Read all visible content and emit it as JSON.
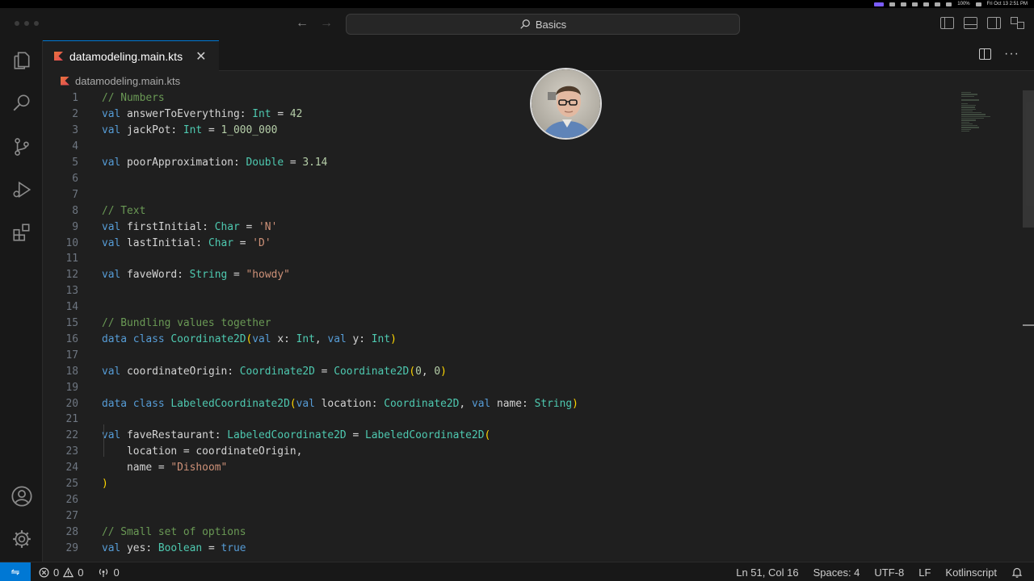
{
  "titlebar": {
    "search_label": "Basics",
    "menubar_clock": "Fri Oct 13  2:51 PM",
    "battery": "100%"
  },
  "tab": {
    "label": "datamodeling.main.kts"
  },
  "breadcrumb": {
    "label": "datamodeling.main.kts"
  },
  "editor": {
    "lines": [
      {
        "n": "1",
        "tokens": [
          [
            "cm",
            "// Numbers"
          ]
        ]
      },
      {
        "n": "2",
        "tokens": [
          [
            "kw",
            "val "
          ],
          [
            "pl",
            "answerToEverything: "
          ],
          [
            "ty",
            "Int"
          ],
          [
            "pl",
            " = "
          ],
          [
            "nm",
            "42"
          ]
        ]
      },
      {
        "n": "3",
        "tokens": [
          [
            "kw",
            "val "
          ],
          [
            "pl",
            "jackPot: "
          ],
          [
            "ty",
            "Int"
          ],
          [
            "pl",
            " = "
          ],
          [
            "nm",
            "1_000_000"
          ]
        ]
      },
      {
        "n": "4",
        "tokens": []
      },
      {
        "n": "5",
        "tokens": [
          [
            "kw",
            "val "
          ],
          [
            "pl",
            "poorApproximation: "
          ],
          [
            "ty",
            "Double"
          ],
          [
            "pl",
            " = "
          ],
          [
            "nm",
            "3.14"
          ]
        ]
      },
      {
        "n": "6",
        "tokens": []
      },
      {
        "n": "7",
        "tokens": []
      },
      {
        "n": "8",
        "tokens": [
          [
            "cm",
            "// Text"
          ]
        ]
      },
      {
        "n": "9",
        "tokens": [
          [
            "kw",
            "val "
          ],
          [
            "pl",
            "firstInitial: "
          ],
          [
            "ty",
            "Char"
          ],
          [
            "pl",
            " = "
          ],
          [
            "st",
            "'N'"
          ]
        ]
      },
      {
        "n": "10",
        "tokens": [
          [
            "kw",
            "val "
          ],
          [
            "pl",
            "lastInitial: "
          ],
          [
            "ty",
            "Char"
          ],
          [
            "pl",
            " = "
          ],
          [
            "st",
            "'D'"
          ]
        ]
      },
      {
        "n": "11",
        "tokens": []
      },
      {
        "n": "12",
        "tokens": [
          [
            "kw",
            "val "
          ],
          [
            "pl",
            "faveWord: "
          ],
          [
            "ty",
            "String"
          ],
          [
            "pl",
            " = "
          ],
          [
            "st",
            "\"howdy\""
          ]
        ]
      },
      {
        "n": "13",
        "tokens": []
      },
      {
        "n": "14",
        "tokens": []
      },
      {
        "n": "15",
        "tokens": [
          [
            "cm",
            "// Bundling values together"
          ]
        ]
      },
      {
        "n": "16",
        "tokens": [
          [
            "kw",
            "data class "
          ],
          [
            "ty",
            "Coordinate2D"
          ],
          [
            "br",
            "("
          ],
          [
            "kw",
            "val "
          ],
          [
            "pl",
            "x: "
          ],
          [
            "ty",
            "Int"
          ],
          [
            "pl",
            ", "
          ],
          [
            "kw",
            "val "
          ],
          [
            "pl",
            "y: "
          ],
          [
            "ty",
            "Int"
          ],
          [
            "br",
            ")"
          ]
        ]
      },
      {
        "n": "17",
        "tokens": []
      },
      {
        "n": "18",
        "tokens": [
          [
            "kw",
            "val "
          ],
          [
            "pl",
            "coordinateOrigin: "
          ],
          [
            "ty",
            "Coordinate2D"
          ],
          [
            "pl",
            " = "
          ],
          [
            "fn",
            "Coordinate2D"
          ],
          [
            "br",
            "("
          ],
          [
            "nm",
            "0"
          ],
          [
            "pl",
            ", "
          ],
          [
            "nm",
            "0"
          ],
          [
            "br",
            ")"
          ]
        ]
      },
      {
        "n": "19",
        "tokens": []
      },
      {
        "n": "20",
        "tokens": [
          [
            "kw",
            "data class "
          ],
          [
            "ty",
            "LabeledCoordinate2D"
          ],
          [
            "br",
            "("
          ],
          [
            "kw",
            "val "
          ],
          [
            "pl",
            "location: "
          ],
          [
            "ty",
            "Coordinate2D"
          ],
          [
            "pl",
            ", "
          ],
          [
            "kw",
            "val "
          ],
          [
            "pl",
            "name: "
          ],
          [
            "ty",
            "String"
          ],
          [
            "br",
            ")"
          ]
        ]
      },
      {
        "n": "21",
        "tokens": []
      },
      {
        "n": "22",
        "tokens": [
          [
            "kw",
            "val "
          ],
          [
            "pl",
            "faveRestaurant: "
          ],
          [
            "ty",
            "LabeledCoordinate2D"
          ],
          [
            "pl",
            " = "
          ],
          [
            "fn",
            "LabeledCoordinate2D"
          ],
          [
            "br",
            "("
          ]
        ]
      },
      {
        "n": "23",
        "tokens": [
          [
            "pl",
            "    location = coordinateOrigin,"
          ]
        ]
      },
      {
        "n": "24",
        "tokens": [
          [
            "pl",
            "    name = "
          ],
          [
            "st",
            "\"Dishoom\""
          ]
        ]
      },
      {
        "n": "25",
        "tokens": [
          [
            "br",
            ")"
          ]
        ]
      },
      {
        "n": "26",
        "tokens": []
      },
      {
        "n": "27",
        "tokens": []
      },
      {
        "n": "28",
        "tokens": [
          [
            "cm",
            "// Small set of options"
          ]
        ]
      },
      {
        "n": "29",
        "tokens": [
          [
            "kw",
            "val "
          ],
          [
            "pl",
            "yes: "
          ],
          [
            "ty",
            "Boolean"
          ],
          [
            "pl",
            " = "
          ],
          [
            "kw",
            "true"
          ]
        ]
      }
    ]
  },
  "statusbar": {
    "errors": "0",
    "warnings": "0",
    "ports": "0",
    "cursor": "Ln 51, Col 16",
    "spaces": "Spaces: 4",
    "encoding": "UTF-8",
    "eol": "LF",
    "language": "Kotlinscript"
  },
  "colors": {
    "accent": "#0078d4",
    "editor_bg": "#1f1f1f",
    "chrome_bg": "#181818"
  },
  "icons": [
    "explorer-icon",
    "search-icon",
    "source-control-icon",
    "run-debug-icon",
    "extensions-icon",
    "account-icon",
    "settings-gear-icon",
    "bell-icon",
    "split-editor-icon"
  ]
}
